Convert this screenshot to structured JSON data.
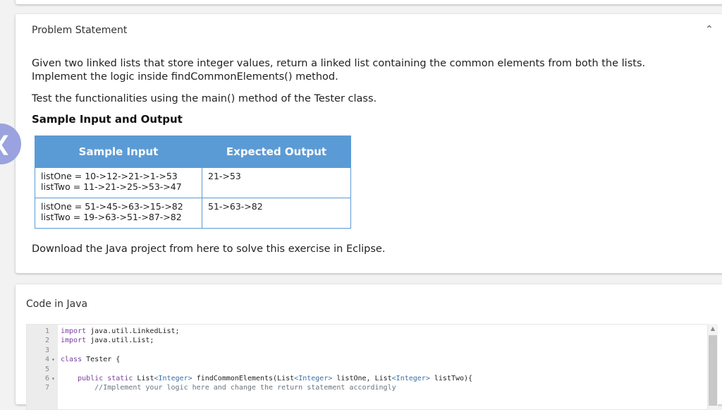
{
  "problem": {
    "title": "Problem Statement",
    "collapse_icon": "chevron-up-icon",
    "para1": "Given two linked lists that store integer values, return a linked list containing the common elements from both the lists. Implement the logic inside findCommonElements() method.",
    "para2": "Test the functionalities using the main() method of the Tester class.",
    "sample_heading": "Sample Input and Output",
    "table": {
      "headers": [
        "Sample Input",
        "Expected Output"
      ],
      "rows": [
        {
          "input_line1": "listOne = 10->12->21->1->53",
          "input_line2": "listTwo = 11->21->25->53->47",
          "output": "21->53"
        },
        {
          "input_line1": "listOne = 51->45->63->15->82",
          "input_line2": "listTwo = 19->63->51->87->82",
          "output": "51->63->82"
        }
      ]
    },
    "para3": "Download the Java project from here to solve this exercise in Eclipse."
  },
  "nav": {
    "prev_icon": "chevron-left-icon",
    "prev_glyph": "‹"
  },
  "code": {
    "title": "Code in Java",
    "lines": [
      {
        "num": "1",
        "fold": "",
        "text": "import java.util.LinkedList;"
      },
      {
        "num": "2",
        "fold": "",
        "text": "import java.util.List;"
      },
      {
        "num": "3",
        "fold": "",
        "text": ""
      },
      {
        "num": "4",
        "fold": "▾",
        "text": "class Tester {"
      },
      {
        "num": "5",
        "fold": "",
        "text": ""
      },
      {
        "num": "6",
        "fold": "▾",
        "text": "    public static List<Integer> findCommonElements(List<Integer> listOne, List<Integer> listTwo){"
      },
      {
        "num": "7",
        "fold": "",
        "text": "        //Implement your logic here and change the return statement accordingly"
      }
    ]
  }
}
